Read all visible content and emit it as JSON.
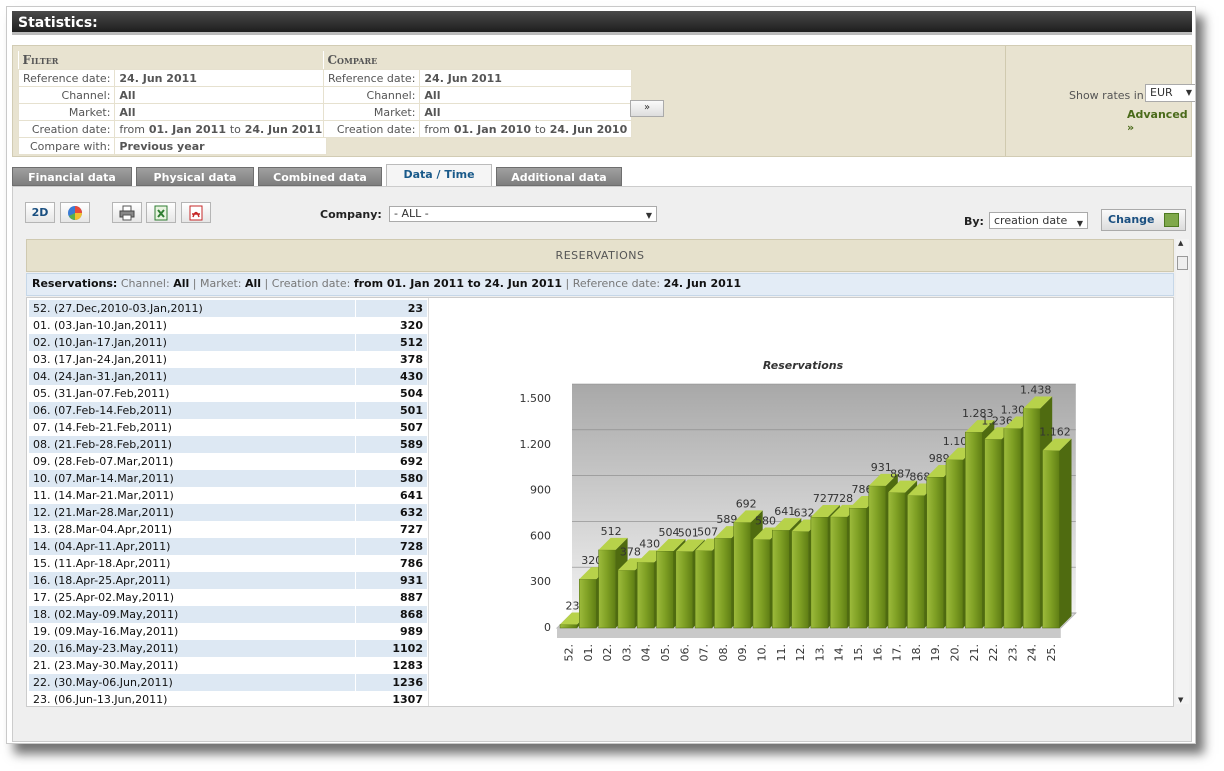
{
  "window": {
    "title": "Statistics:"
  },
  "filter": {
    "heading": "Filter",
    "rows": [
      {
        "label": "Reference date:",
        "value": "24. Jun 2011"
      },
      {
        "label": "Channel:",
        "value": "All"
      },
      {
        "label": "Market:",
        "value": "All"
      },
      {
        "label": "Creation date:",
        "from_word": "from",
        "from": "01. Jan 2011",
        "to_word": "to",
        "to": "24. Jun 2011"
      },
      {
        "label": "Compare with:",
        "value": "Previous year"
      }
    ]
  },
  "compare": {
    "heading": "Compare",
    "rows": [
      {
        "label": "Reference date:",
        "value": "24. Jun 2011"
      },
      {
        "label": "Channel:",
        "value": "All"
      },
      {
        "label": "Market:",
        "value": "All"
      },
      {
        "label": "Creation date:",
        "from_word": "from",
        "from": "01. Jan 2010",
        "to_word": "to",
        "to": "24. Jun 2010"
      }
    ],
    "go_label": "»"
  },
  "rates": {
    "label": "Show rates in:",
    "selected": "EUR",
    "advanced_label": "Advanced »"
  },
  "tabs": [
    {
      "label": "Financial data",
      "active": false
    },
    {
      "label": "Physical data",
      "active": false
    },
    {
      "label": "Combined data",
      "active": false
    },
    {
      "label": "Data / Time",
      "active": true
    },
    {
      "label": "Additional data",
      "active": false
    }
  ],
  "toolbar": {
    "btn_2d": "2D",
    "company_label": "Company:",
    "company_value": "- ALL -",
    "by_label": "By:",
    "by_value": "creation date",
    "change_label": "Change"
  },
  "report": {
    "heading": "RESERVATIONS",
    "summary": {
      "name": "Reservations:",
      "channel_label": "Channel:",
      "channel": "All",
      "market_label": "Market:",
      "market": "All",
      "creation_label": "Creation date:",
      "creation": "from 01. Jan 2011 to 24. Jun 2011",
      "reference_label": "Reference date:",
      "reference": "24. Jun 2011"
    },
    "rows": [
      {
        "week": "52. (27.Dec,2010-03.Jan,2011)",
        "value": "23"
      },
      {
        "week": "01. (03.Jan-10.Jan,2011)",
        "value": "320"
      },
      {
        "week": "02. (10.Jan-17.Jan,2011)",
        "value": "512"
      },
      {
        "week": "03. (17.Jan-24.Jan,2011)",
        "value": "378"
      },
      {
        "week": "04. (24.Jan-31.Jan,2011)",
        "value": "430"
      },
      {
        "week": "05. (31.Jan-07.Feb,2011)",
        "value": "504"
      },
      {
        "week": "06. (07.Feb-14.Feb,2011)",
        "value": "501"
      },
      {
        "week": "07. (14.Feb-21.Feb,2011)",
        "value": "507"
      },
      {
        "week": "08. (21.Feb-28.Feb,2011)",
        "value": "589"
      },
      {
        "week": "09. (28.Feb-07.Mar,2011)",
        "value": "692"
      },
      {
        "week": "10. (07.Mar-14.Mar,2011)",
        "value": "580"
      },
      {
        "week": "11. (14.Mar-21.Mar,2011)",
        "value": "641"
      },
      {
        "week": "12. (21.Mar-28.Mar,2011)",
        "value": "632"
      },
      {
        "week": "13. (28.Mar-04.Apr,2011)",
        "value": "727"
      },
      {
        "week": "14. (04.Apr-11.Apr,2011)",
        "value": "728"
      },
      {
        "week": "15. (11.Apr-18.Apr,2011)",
        "value": "786"
      },
      {
        "week": "16. (18.Apr-25.Apr,2011)",
        "value": "931"
      },
      {
        "week": "17. (25.Apr-02.May,2011)",
        "value": "887"
      },
      {
        "week": "18. (02.May-09.May,2011)",
        "value": "868"
      },
      {
        "week": "19. (09.May-16.May,2011)",
        "value": "989"
      },
      {
        "week": "20. (16.May-23.May,2011)",
        "value": "1102"
      },
      {
        "week": "21. (23.May-30.May,2011)",
        "value": "1283"
      },
      {
        "week": "22. (30.May-06.Jun,2011)",
        "value": "1236"
      },
      {
        "week": "23. (06.Jun-13.Jun,2011)",
        "value": "1307"
      }
    ]
  },
  "chart_data": {
    "type": "bar",
    "title": "Reservations",
    "categories": [
      "52.",
      "01.",
      "02.",
      "03.",
      "04.",
      "05.",
      "06.",
      "07.",
      "08.",
      "09.",
      "10.",
      "11.",
      "12.",
      "13.",
      "14.",
      "15.",
      "16.",
      "17.",
      "18.",
      "19.",
      "20.",
      "21.",
      "22.",
      "23.",
      "24.",
      "25."
    ],
    "values": [
      23,
      320,
      512,
      378,
      430,
      504,
      501,
      507,
      589,
      692,
      580,
      641,
      632,
      727,
      728,
      786,
      931,
      887,
      868,
      989,
      1102,
      1283,
      1236,
      1307,
      1438,
      1162
    ],
    "value_labels": [
      "23",
      "320",
      "512",
      "378",
      "430",
      "504",
      "501",
      "507",
      "589",
      "692",
      "580",
      "641",
      "632",
      "727",
      "728",
      "786",
      "931",
      "887",
      "868",
      "989",
      "1.102",
      "1.283",
      "1.236",
      "1.307",
      "1.438",
      "1.162"
    ],
    "yticks": [
      "0",
      "300",
      "600",
      "900",
      "1.200",
      "1.500"
    ],
    "ylim": [
      0,
      1500
    ],
    "bar_color": "#7da024"
  }
}
